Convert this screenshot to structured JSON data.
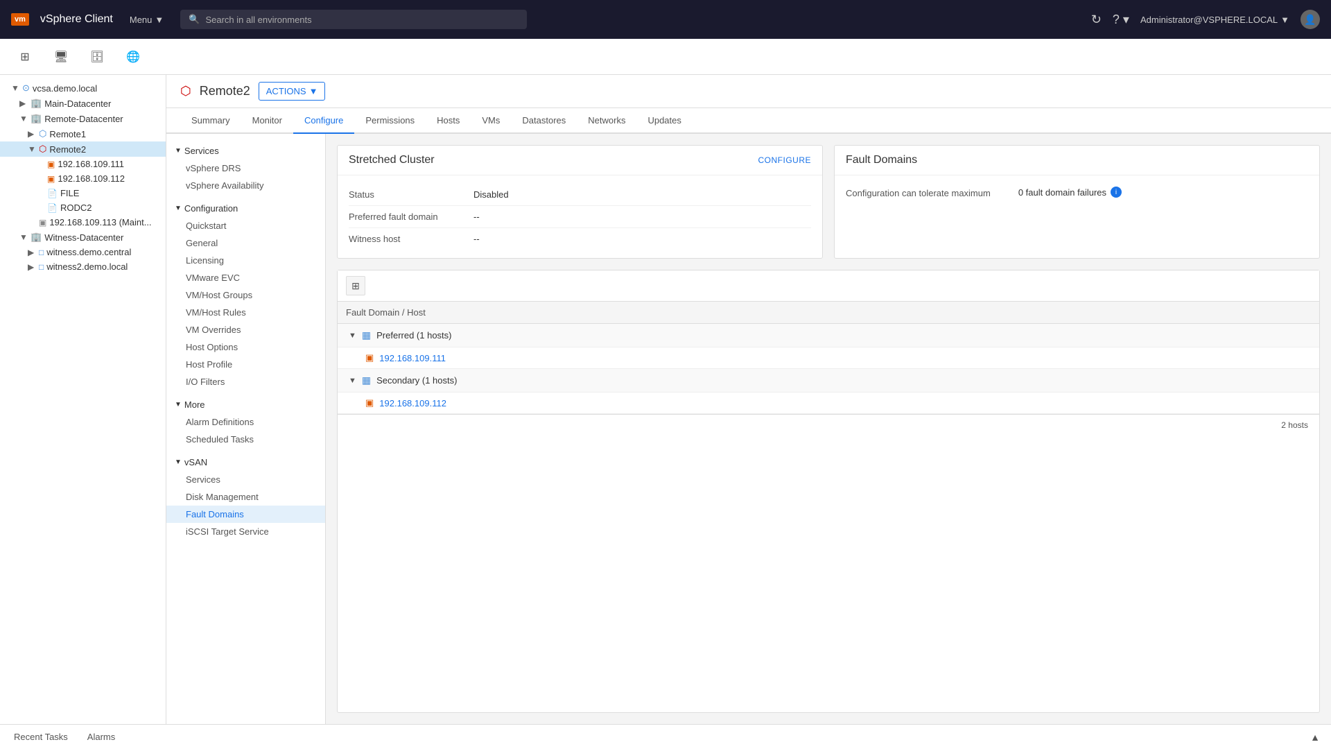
{
  "app": {
    "logo": "vm",
    "title": "vSphere Client",
    "menu_label": "Menu",
    "search_placeholder": "Search in all environments",
    "user": "Administrator@VSPHERE.LOCAL",
    "refresh_icon": "↻",
    "help_icon": "?",
    "user_icon": "👤"
  },
  "icon_bar": {
    "icons": [
      "⊞",
      "🖥",
      "🗄",
      "🌐"
    ]
  },
  "sidebar": {
    "items": [
      {
        "id": "vcsa",
        "label": "vcsa.demo.local",
        "level": 0,
        "type": "vcenter",
        "expanded": true
      },
      {
        "id": "main-dc",
        "label": "Main-Datacenter",
        "level": 1,
        "type": "datacenter",
        "expanded": false
      },
      {
        "id": "remote-dc",
        "label": "Remote-Datacenter",
        "level": 1,
        "type": "datacenter",
        "expanded": true
      },
      {
        "id": "remote1",
        "label": "Remote1",
        "level": 2,
        "type": "cluster",
        "expanded": false
      },
      {
        "id": "remote2",
        "label": "Remote2",
        "level": 2,
        "type": "cluster-selected",
        "expanded": true,
        "selected": true
      },
      {
        "id": "ip111",
        "label": "192.168.109.111",
        "level": 3,
        "type": "host"
      },
      {
        "id": "ip112",
        "label": "192.168.109.112",
        "level": 3,
        "type": "host"
      },
      {
        "id": "file",
        "label": "FILE",
        "level": 3,
        "type": "file"
      },
      {
        "id": "rodc2",
        "label": "RODC2",
        "level": 3,
        "type": "vm"
      },
      {
        "id": "ip113",
        "label": "192.168.109.113 (Maint...",
        "level": 2,
        "type": "host-maint"
      },
      {
        "id": "witness-dc",
        "label": "Witness-Datacenter",
        "level": 1,
        "type": "datacenter",
        "expanded": true
      },
      {
        "id": "witness1",
        "label": "witness.demo.central",
        "level": 2,
        "type": "host"
      },
      {
        "id": "witness2",
        "label": "witness2.demo.local",
        "level": 2,
        "type": "host"
      }
    ]
  },
  "title_bar": {
    "title": "Remote2",
    "actions_label": "ACTIONS"
  },
  "tabs": [
    {
      "id": "summary",
      "label": "Summary"
    },
    {
      "id": "monitor",
      "label": "Monitor"
    },
    {
      "id": "configure",
      "label": "Configure",
      "active": true
    },
    {
      "id": "permissions",
      "label": "Permissions"
    },
    {
      "id": "hosts",
      "label": "Hosts"
    },
    {
      "id": "vms",
      "label": "VMs"
    },
    {
      "id": "datastores",
      "label": "Datastores"
    },
    {
      "id": "networks",
      "label": "Networks"
    },
    {
      "id": "updates",
      "label": "Updates"
    }
  ],
  "config_menu": {
    "sections": [
      {
        "id": "services",
        "label": "Services",
        "expanded": true,
        "items": [
          {
            "id": "vsphere-drs",
            "label": "vSphere DRS"
          },
          {
            "id": "vsphere-avail",
            "label": "vSphere Availability"
          }
        ]
      },
      {
        "id": "configuration",
        "label": "Configuration",
        "expanded": true,
        "items": [
          {
            "id": "quickstart",
            "label": "Quickstart"
          },
          {
            "id": "general",
            "label": "General"
          },
          {
            "id": "licensing",
            "label": "Licensing"
          },
          {
            "id": "vmware-evc",
            "label": "VMware EVC"
          },
          {
            "id": "vm-host-groups",
            "label": "VM/Host Groups"
          },
          {
            "id": "vm-host-rules",
            "label": "VM/Host Rules"
          },
          {
            "id": "vm-overrides",
            "label": "VM Overrides"
          },
          {
            "id": "host-options",
            "label": "Host Options"
          },
          {
            "id": "host-profile",
            "label": "Host Profile"
          },
          {
            "id": "io-filters",
            "label": "I/O Filters"
          }
        ]
      },
      {
        "id": "more",
        "label": "More",
        "expanded": true,
        "items": [
          {
            "id": "alarm-definitions",
            "label": "Alarm Definitions"
          },
          {
            "id": "scheduled-tasks",
            "label": "Scheduled Tasks"
          }
        ]
      },
      {
        "id": "vsan",
        "label": "vSAN",
        "expanded": true,
        "items": [
          {
            "id": "vsan-services",
            "label": "Services"
          },
          {
            "id": "disk-management",
            "label": "Disk Management"
          },
          {
            "id": "fault-domains",
            "label": "Fault Domains",
            "active": true
          },
          {
            "id": "iscsi-target",
            "label": "iSCSI Target Service"
          }
        ]
      }
    ]
  },
  "stretched_cluster": {
    "title": "Stretched Cluster",
    "configure_label": "CONFIGURE",
    "rows": [
      {
        "label": "Status",
        "value": "Disabled"
      },
      {
        "label": "Preferred fault domain",
        "value": "--"
      },
      {
        "label": "Witness host",
        "value": "--"
      }
    ]
  },
  "fault_domains": {
    "card_title": "Fault Domains",
    "description": "Configuration can tolerate maximum",
    "fault_count_label": "0 fault domain failures",
    "table_column": "Fault Domain / Host",
    "toolbar_icon": "⊞",
    "groups": [
      {
        "id": "preferred",
        "label": "Preferred (1 hosts)",
        "expanded": true,
        "hosts": [
          {
            "id": "host111",
            "label": "192.168.109.111"
          }
        ]
      },
      {
        "id": "secondary",
        "label": "Secondary (1 hosts)",
        "expanded": true,
        "hosts": [
          {
            "id": "host112",
            "label": "192.168.109.112"
          }
        ]
      }
    ],
    "footer": "2 hosts"
  },
  "bottom_bar": {
    "tabs": [
      {
        "id": "recent-tasks",
        "label": "Recent Tasks",
        "active": false
      },
      {
        "id": "alarms",
        "label": "Alarms",
        "active": false
      }
    ],
    "expand_icon": "▲"
  }
}
